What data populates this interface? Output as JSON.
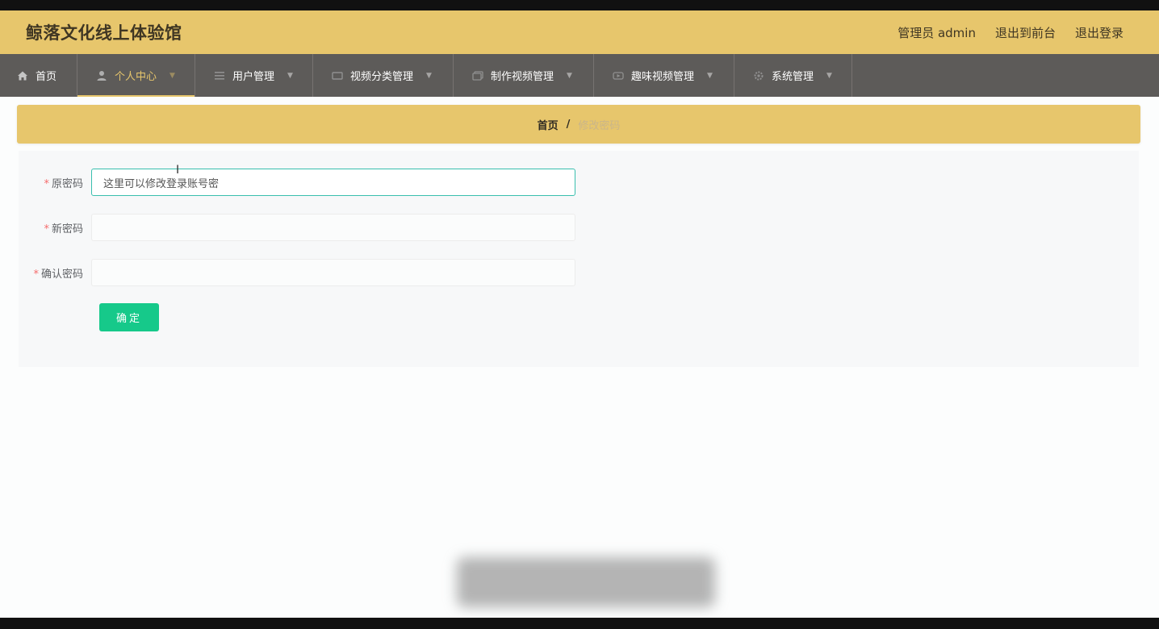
{
  "header": {
    "title": "鲸落文化线上体验馆",
    "admin_label": "管理员 admin",
    "goto_front": "退出到前台",
    "logout": "退出登录"
  },
  "nav": {
    "items": [
      {
        "label": "首页",
        "icon": "home-icon"
      },
      {
        "label": "个人中心",
        "icon": "user-icon",
        "active": true
      },
      {
        "label": "用户管理",
        "icon": "list-icon"
      },
      {
        "label": "视频分类管理",
        "icon": "video-category-icon"
      },
      {
        "label": "制作视频管理",
        "icon": "video-make-icon"
      },
      {
        "label": "趣味视频管理",
        "icon": "video-fun-icon"
      },
      {
        "label": "系统管理",
        "icon": "gear-icon"
      }
    ]
  },
  "breadcrumb": {
    "home": "首页",
    "separator": "/",
    "current": "修改密码"
  },
  "form": {
    "old_password_label": "原密码",
    "old_password_value": "这里可以修改登录账号密",
    "new_password_label": "新密码",
    "new_password_value": "",
    "confirm_password_label": "确认密码",
    "confirm_password_value": "",
    "required_mark": "*",
    "submit_label": "确定"
  },
  "colors": {
    "header_bg": "#e7c66c",
    "nav_bg": "#5d5b59",
    "accent": "#e7c66c",
    "button": "#16c98a",
    "focus_border": "#39bfae"
  }
}
